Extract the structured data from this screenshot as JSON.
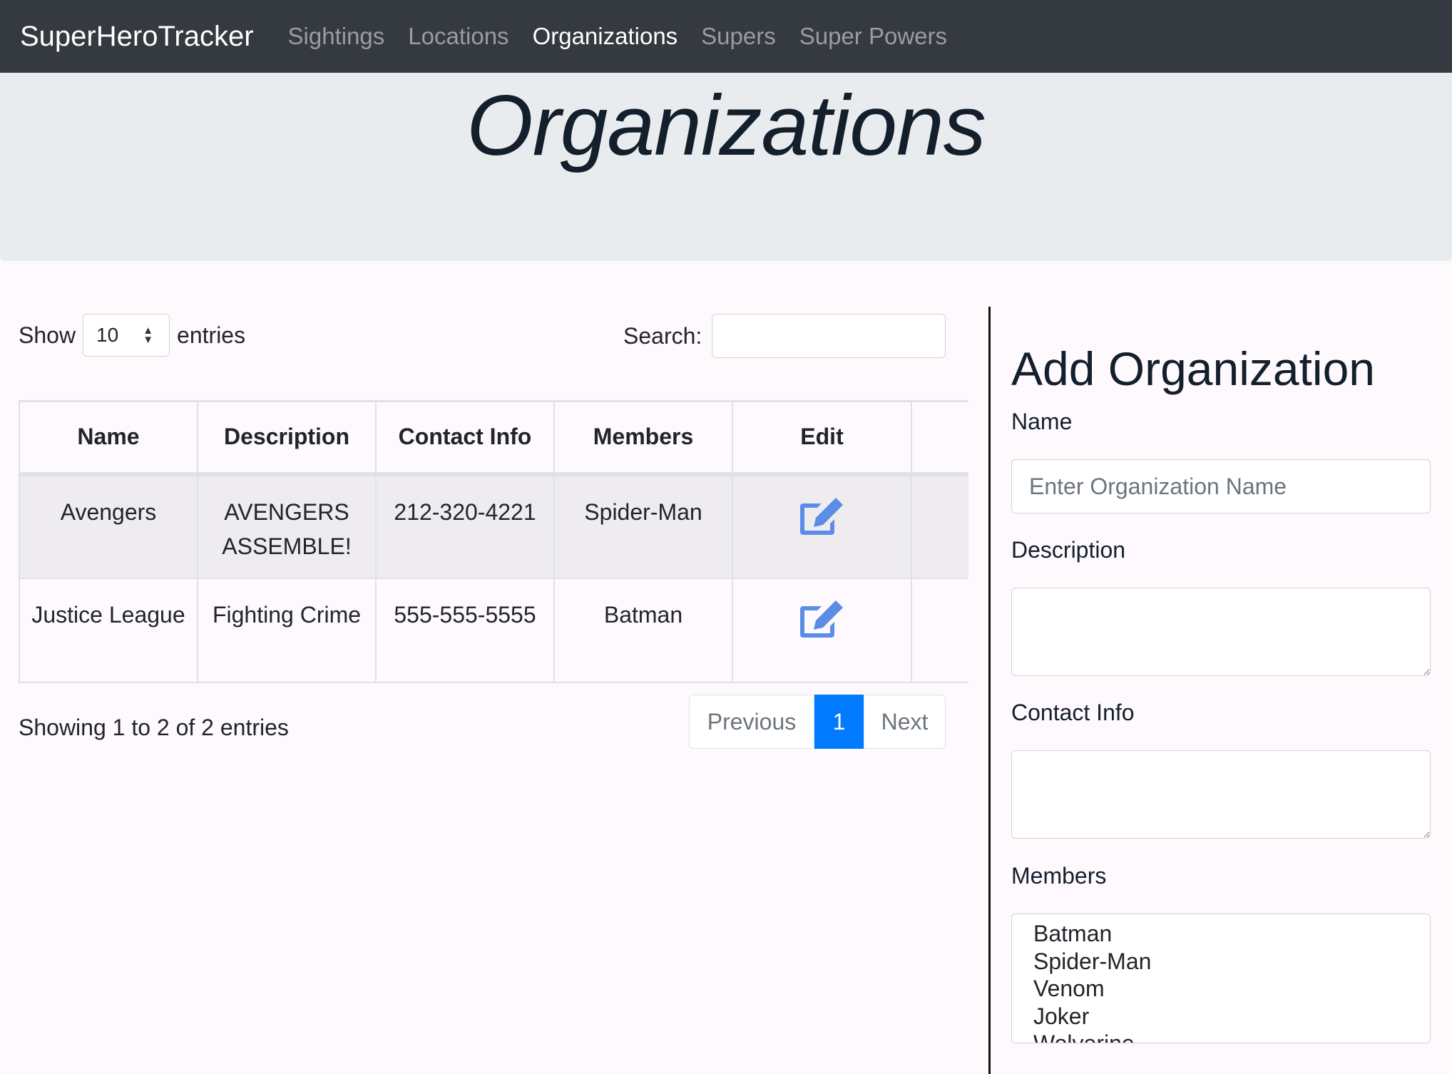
{
  "navbar": {
    "brand": "SuperHeroTracker",
    "links": [
      {
        "label": "Sightings",
        "active": false
      },
      {
        "label": "Locations",
        "active": false
      },
      {
        "label": "Organizations",
        "active": true
      },
      {
        "label": "Supers",
        "active": false
      },
      {
        "label": "Super Powers",
        "active": false
      }
    ]
  },
  "page": {
    "title": "Organizations"
  },
  "table_controls": {
    "show_label": "Show",
    "entries_label": "entries",
    "page_length": "10",
    "search_label": "Search:",
    "search_value": ""
  },
  "table": {
    "columns": [
      "Name",
      "Description",
      "Contact Info",
      "Members",
      "Edit"
    ],
    "rows": [
      {
        "name": "Avengers",
        "description": "AVENGERS ASSEMBLE!",
        "contact": "212-320-4221",
        "members": "Spider-Man"
      },
      {
        "name": "Justice League",
        "description": "Fighting Crime",
        "contact": "555-555-5555",
        "members": "Batman"
      }
    ],
    "edit_icon": "edit-icon",
    "edit_icon_color": "#5b8de6"
  },
  "table_footer": {
    "info": "Showing 1 to 2 of 2 entries",
    "previous_label": "Previous",
    "current_page": "1",
    "next_label": "Next"
  },
  "form": {
    "title": "Add Organization",
    "name_label": "Name",
    "name_placeholder": "Enter Organization Name",
    "description_label": "Description",
    "contact_label": "Contact Info",
    "members_label": "Members",
    "member_options": [
      "Batman",
      "Spider-Man",
      "Venom",
      "Joker",
      "Wolverine"
    ]
  },
  "colors": {
    "navbar_bg": "#343a40",
    "jumbotron_bg": "#e9ecef",
    "page_bg": "#fdf9fd",
    "accent": "#007bff"
  }
}
